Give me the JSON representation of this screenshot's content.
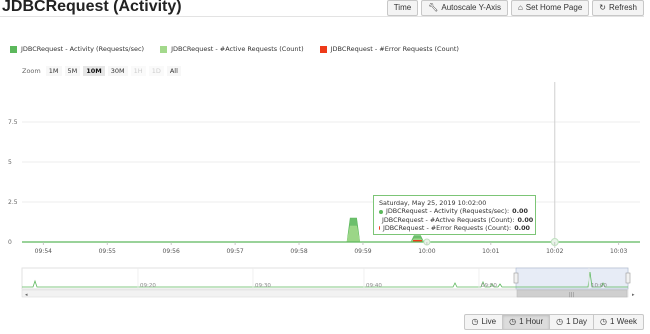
{
  "page": {
    "title": "JDBCRequest (Activity)"
  },
  "toolbar": [
    {
      "label": "Time",
      "icon": ""
    },
    {
      "label": "Autoscale Y-Axis",
      "icon": "wrench-icon"
    },
    {
      "label": "Set Home Page",
      "icon": "home-icon"
    },
    {
      "label": "Refresh",
      "icon": "refresh-icon"
    }
  ],
  "legend": [
    {
      "label": "JDBCRequest - Activity (Requests/sec)",
      "color": "#5cb85c"
    },
    {
      "label": "JDBCRequest - #Active Requests (Count)",
      "color": "#a3d98c"
    },
    {
      "label": "JDBCRequest - #Error Requests (Count)",
      "color": "#ee3a19"
    }
  ],
  "zoom": {
    "label": "Zoom",
    "options": [
      {
        "label": "1M",
        "state": "normal"
      },
      {
        "label": "5M",
        "state": "normal"
      },
      {
        "label": "10M",
        "state": "selected"
      },
      {
        "label": "30M",
        "state": "normal"
      },
      {
        "label": "1H",
        "state": "disabled"
      },
      {
        "label": "1D",
        "state": "disabled"
      },
      {
        "label": "All",
        "state": "normal"
      }
    ]
  },
  "chart_data": {
    "type": "area",
    "title": "",
    "xlabel": "",
    "ylabel": "",
    "ylim": [
      0,
      10
    ],
    "yticks": [
      "0",
      "2.5",
      "5",
      "7.5"
    ],
    "x_tick_labels": [
      "09:54",
      "09:55",
      "09:56",
      "09:57",
      "09:58",
      "09:59",
      "10:00",
      "10:01",
      "10:02",
      "10:03"
    ],
    "series": [
      {
        "name": "JDBCRequest - Activity (Requests/sec)",
        "color": "#5cb85c",
        "x": [
          "09:58:45",
          "09:58:48",
          "09:58:54",
          "09:58:57",
          "09:59:45",
          "09:59:48",
          "09:59:54",
          "09:59:57"
        ],
        "values": [
          0,
          1.5,
          1.5,
          0,
          0,
          0.4,
          0.4,
          0
        ]
      },
      {
        "name": "JDBCRequest - #Active Requests (Count)",
        "color": "#a3d98c",
        "x": [
          "09:58:45",
          "09:58:48",
          "09:58:54",
          "09:58:57",
          "09:59:45",
          "09:59:48",
          "09:59:54",
          "09:59:57"
        ],
        "values": [
          0,
          1.0,
          1.0,
          0,
          0,
          0.2,
          0.2,
          0
        ]
      },
      {
        "name": "JDBCRequest - #Error Requests (Count)",
        "color": "#ee3a19",
        "x": [
          "09:58:45",
          "09:59:57"
        ],
        "values": [
          0,
          0
        ]
      }
    ],
    "legend": "top-left",
    "grid": true
  },
  "navigator": {
    "tick_labels": [
      "09:20",
      "09:30",
      "09:40",
      "09:50",
      "10:00"
    ]
  },
  "tooltip": {
    "header": "Saturday, May 25, 2019 10:02:00",
    "rows": [
      {
        "label": "JDBCRequest - Activity (Requests/sec):",
        "value": "0.00",
        "color": "#5cb85c"
      },
      {
        "label": "JDBCRequest - #Active Requests (Count):",
        "value": "0.00",
        "color": "#a3d98c"
      },
      {
        "label": "JDBCRequest - #Error Requests (Count):",
        "value": "0.00",
        "color": "#ee3a19"
      }
    ]
  },
  "range_buttons": [
    {
      "label": "Live",
      "icon": "clock-icon",
      "active": false
    },
    {
      "label": "1 Hour",
      "icon": "clock-icon",
      "active": true
    },
    {
      "label": "1 Day",
      "icon": "clock-icon",
      "active": false
    },
    {
      "label": "1 Week",
      "icon": "clock-icon",
      "active": false
    }
  ]
}
